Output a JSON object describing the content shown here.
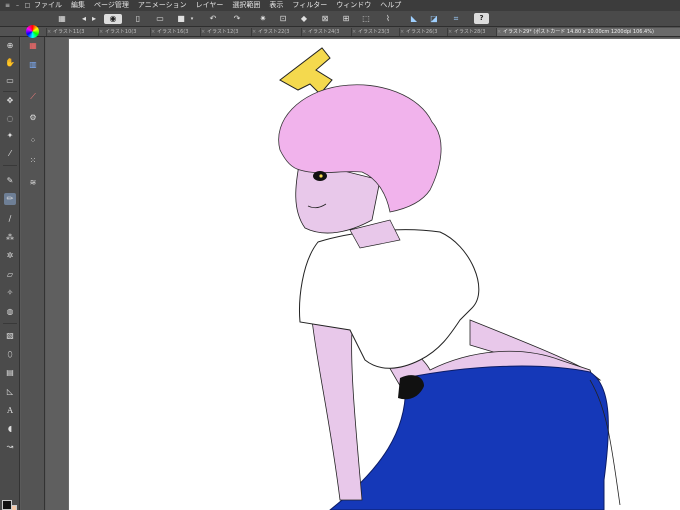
{
  "menu": {
    "items": [
      "ファイル",
      "編集",
      "ページ管理",
      "アニメーション",
      "レイヤー",
      "選択範囲",
      "表示",
      "フィルター",
      "ウィンドウ",
      "ヘルプ"
    ]
  },
  "command_bar": {
    "help_label": "?"
  },
  "tabs": [
    {
      "label": "イラスト11(3"
    },
    {
      "label": "イラスト10(3"
    },
    {
      "label": "イラスト16(3"
    },
    {
      "label": "イラスト12(3"
    },
    {
      "label": "イラスト22(3"
    },
    {
      "label": "イラスト24(3"
    },
    {
      "label": "イラスト23(3"
    },
    {
      "label": "イラスト26(3"
    },
    {
      "label": "イラスト28(3"
    },
    {
      "label": "イラスト29* (ポストカード 14.80 x 10.00cm 1200dpi 106.4%)"
    }
  ],
  "colors": {
    "main_color": "#111111",
    "sub_color": "#f5c9a9",
    "hair": "#f1b3ec",
    "skin": "#e8c8ea",
    "jeans": "#1538b8",
    "horn": "#f4d94e"
  },
  "tool_icons": [
    "zoom-icon",
    "hand-icon",
    "operation-icon",
    "move-icon",
    "lasso-icon",
    "magic-wand-icon",
    "eyedropper-icon",
    "pen-icon",
    "pencil-icon",
    "brush-icon",
    "airbrush-icon",
    "decoration-icon",
    "eraser-icon",
    "blend-icon",
    "fill-icon",
    "gradient-icon",
    "figure-icon",
    "frame-icon",
    "ruler-icon",
    "text-icon",
    "balloon-icon",
    "correct-line-icon"
  ]
}
